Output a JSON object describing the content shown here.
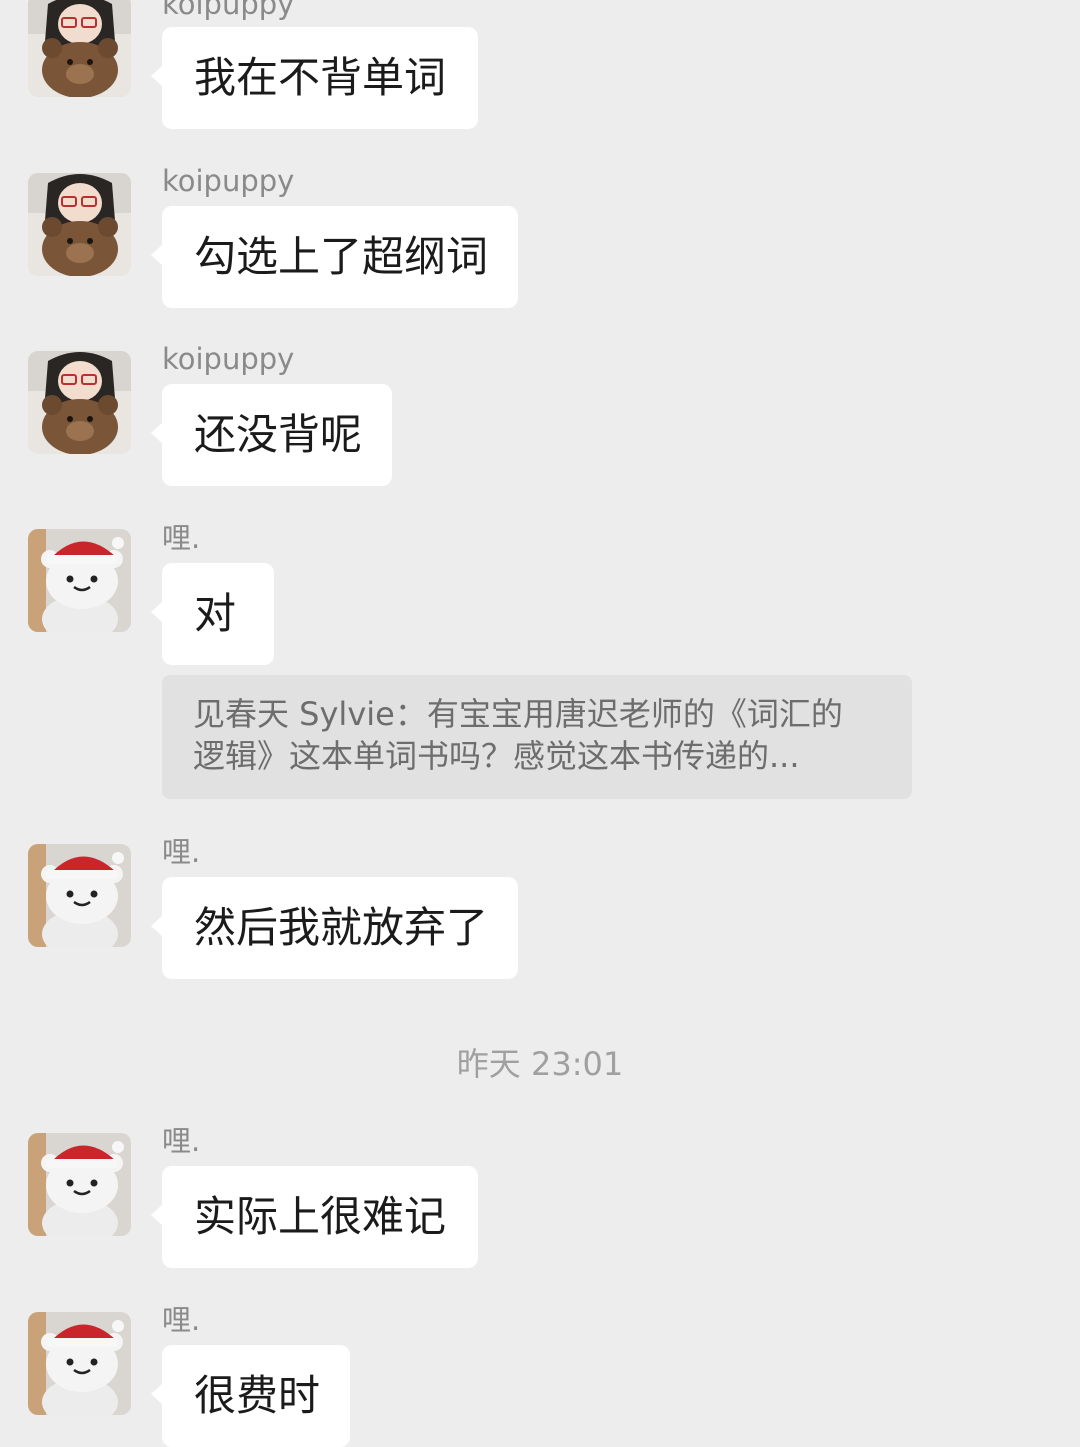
{
  "contacts": {
    "koipuppy": {
      "name": "koipuppy",
      "avatar_icon": "girl-with-teddy-bear-avatar"
    },
    "li": {
      "name": "哩.",
      "avatar_icon": "santa-hat-bear-avatar"
    }
  },
  "messages": [
    {
      "sender": "koipuppy",
      "text": "我在不背单词"
    },
    {
      "sender": "koipuppy",
      "text": "勾选上了超纲词"
    },
    {
      "sender": "koipuppy",
      "text": "还没背呢"
    },
    {
      "sender": "哩.",
      "text": "对",
      "quote": {
        "line1": "见春天 Sylvie：有宝宝用唐迟老师的《词汇的",
        "line2": "逻辑》这本单词书吗？感觉这本书传递的..."
      }
    },
    {
      "sender": "哩.",
      "text": "然后我就放弃了"
    },
    {
      "sender": "哩.",
      "text": "实际上很难记"
    },
    {
      "sender": "哩.",
      "text": "很费时"
    }
  ],
  "timestamp": "昨天 23:01",
  "colors": {
    "background": "#ededed",
    "bubble": "#ffffff",
    "quote_background": "#e1e1e1",
    "sender_text": "#8a8a8a",
    "timestamp_text": "#a0a0a0"
  }
}
